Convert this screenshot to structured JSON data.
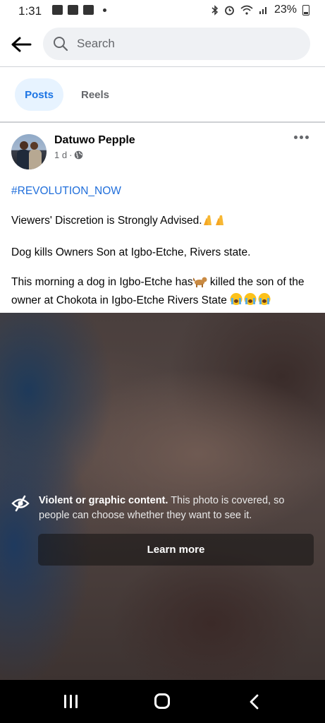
{
  "status_bar": {
    "time": "1:31",
    "battery": "23%"
  },
  "search": {
    "placeholder": "Search"
  },
  "tabs": [
    {
      "label": "Posts",
      "active": true
    },
    {
      "label": "Reels",
      "active": false
    }
  ],
  "post": {
    "author": "Datuwo Pepple",
    "time": "1 d",
    "hashtag": "#REVOLUTION_NOW",
    "line1": "Viewers' Discretion is Strongly Advised.",
    "line2": "Dog kills Owners Son at Igbo-Etche, Rivers state.",
    "line3_a": "This morning a dog in Igbo-Etche has",
    "line3_b": " killed the son of the owner at Chokota in Igbo-Etche Rivers State "
  },
  "media_cover": {
    "title": "Violent or graphic content.",
    "description": " This photo is covered, so people can choose whether they want to see it.",
    "button_label": "Learn more"
  },
  "colors": {
    "accent": "#1b74e4",
    "hashtag": "#216fdb",
    "tab_active_bg": "#e7f3ff"
  }
}
